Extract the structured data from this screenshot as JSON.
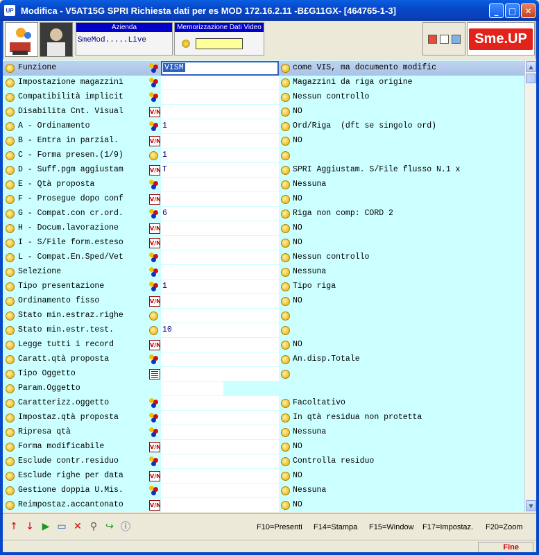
{
  "window": {
    "title": "Modifica -  V5AT15G SPRI Richiesta dati per es MOD 172.16.2.11 -B£G11GX- [464765-1-3]",
    "app_icon_text": "UP",
    "minimize": "_",
    "maximize": "□",
    "close": "✕"
  },
  "header": {
    "azienda_label": "Azienda",
    "azienda_value": "SmeMod.....Live",
    "memo_label": "Memorizzazione Dati Video",
    "logo_text": "Sme.UP"
  },
  "rows": [
    {
      "label": "Funzione",
      "type": "balls",
      "value": "VISM",
      "desc": "come VIS, ma documento modific",
      "selected": true
    },
    {
      "label": "Impostazione magazzini",
      "type": "balls",
      "value": "",
      "desc": "Magazzini da riga origine"
    },
    {
      "label": "Compatibilità implicit",
      "type": "balls",
      "value": "",
      "desc": "Nessun controllo"
    },
    {
      "label": "Disabilita Cnt. Visual",
      "type": "vn",
      "value": "",
      "desc": "NO"
    },
    {
      "label": "A - Ordinamento",
      "type": "balls",
      "value": "1",
      "desc": "Ord/Riga  (dft se singolo ord)"
    },
    {
      "label": "B - Entra in parzial.",
      "type": "vn",
      "value": "",
      "desc": "NO"
    },
    {
      "label": "C - Forma presen.(1/9)",
      "type": "dot",
      "value": "1",
      "desc": ""
    },
    {
      "label": "D - Suff.pgm aggiustam",
      "type": "vn",
      "value": "T",
      "desc": "SPRI Aggiustam. S/File flusso N.1 x"
    },
    {
      "label": "E - Qtà proposta",
      "type": "balls",
      "value": "",
      "desc": "Nessuna"
    },
    {
      "label": "F - Prosegue dopo conf",
      "type": "vn",
      "value": "",
      "desc": "NO"
    },
    {
      "label": "G - Compat.con cr.ord.",
      "type": "balls",
      "value": "6",
      "desc": "Riga non comp: CORD 2"
    },
    {
      "label": "H - Docum.lavorazione",
      "type": "vn",
      "value": "",
      "desc": "NO"
    },
    {
      "label": "I - S/File form.esteso",
      "type": "vn",
      "value": "",
      "desc": "NO"
    },
    {
      "label": "L - Compat.En.Sped/Vet",
      "type": "balls",
      "value": "",
      "desc": "Nessun controllo"
    },
    {
      "label": "Selezione",
      "type": "balls",
      "value": "",
      "desc": "Nessuna"
    },
    {
      "label": "Tipo presentazione",
      "type": "balls",
      "value": "1",
      "desc": "Tipo riga"
    },
    {
      "label": "Ordinamento fisso",
      "type": "vn",
      "value": "",
      "desc": "NO"
    },
    {
      "label": "Stato min.estraz.righe",
      "type": "dot",
      "value": "",
      "desc": ""
    },
    {
      "label": "Stato min.estr.test.",
      "type": "dot",
      "value": "10",
      "desc": ""
    },
    {
      "label": "Legge tutti i record",
      "type": "vn",
      "value": "",
      "desc": "NO"
    },
    {
      "label": "Caratt.qtà proposta",
      "type": "balls",
      "value": "",
      "desc": "An.disp.Totale"
    },
    {
      "label": "Tipo Oggetto",
      "type": "list",
      "value": "",
      "desc": ""
    },
    {
      "label": "Param.Oggetto",
      "type": "none",
      "value": "",
      "desc": ""
    },
    {
      "label": "Caratterizz.oggetto",
      "type": "balls",
      "value": "",
      "desc": "Facoltativo"
    },
    {
      "label": "Impostaz.qtà proposta",
      "type": "balls",
      "value": "",
      "desc": "In qtà residua non protetta"
    },
    {
      "label": "Ripresa qtà",
      "type": "balls",
      "value": "",
      "desc": "Nessuna"
    },
    {
      "label": "Forma modificabile",
      "type": "vn",
      "value": "",
      "desc": "NO"
    },
    {
      "label": "Esclude contr.residuo",
      "type": "balls",
      "value": "",
      "desc": "Controlla residuo"
    },
    {
      "label": "Esclude righe per data",
      "type": "vn",
      "value": "",
      "desc": "NO"
    },
    {
      "label": "Gestione doppia U.Mis.",
      "type": "balls",
      "value": "",
      "desc": "Nessuna"
    },
    {
      "label": "Reimpostaz.accantonato",
      "type": "vn",
      "value": "",
      "desc": "NO"
    }
  ],
  "fkeys": [
    "F10=Presenti",
    "F14=Stampa",
    "F15=Window",
    "F17=Impostaz.",
    "F20=Zoom"
  ],
  "status": {
    "fine": "Fine"
  }
}
